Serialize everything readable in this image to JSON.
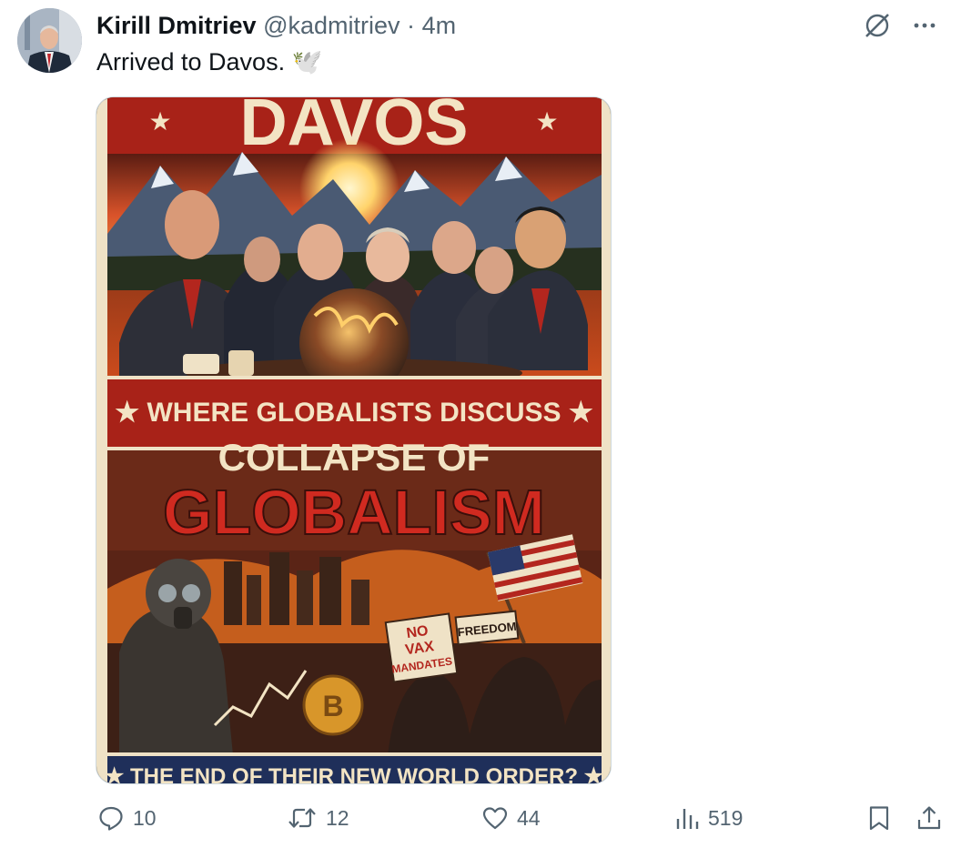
{
  "author": {
    "name": "Kirill Dmitriev",
    "handle": "@kadmitriev",
    "separator": "·",
    "time": "4m"
  },
  "tweet": {
    "text": "Arrived to Davos.",
    "emoji": "🕊️"
  },
  "poster": {
    "title": "DAVOS",
    "banner": "★ WHERE GLOBALISTS DISCUSS ★",
    "headline_1": "COLLAPSE OF",
    "headline_2": "GLOBALISM",
    "sign_1_line_1": "NO",
    "sign_1_line_2": "VAX",
    "sign_1_line_3": "MANDATES",
    "sign_2": "FREEDOM",
    "coin": "B",
    "footer": "★ THE END OF THEIR NEW WORLD ORDER? ★"
  },
  "actions": {
    "replies": "10",
    "reposts": "12",
    "likes": "44",
    "views": "519"
  },
  "icons": {
    "grok": "grok-icon",
    "more": "more-icon",
    "reply": "reply-icon",
    "repost": "repost-icon",
    "like": "heart-icon",
    "views": "views-icon",
    "bookmark": "bookmark-icon",
    "share": "share-icon"
  },
  "colors": {
    "text": "#0f1419",
    "secondary": "#536471",
    "poster_red": "#b3261e",
    "poster_cream": "#efe2c6"
  }
}
